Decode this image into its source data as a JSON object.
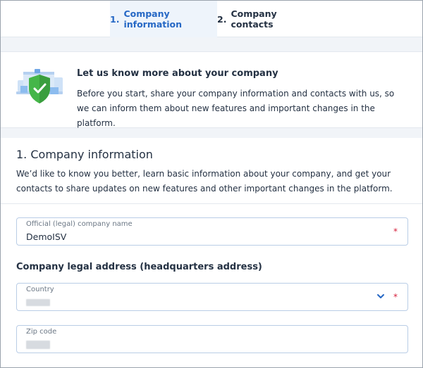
{
  "tabs": [
    {
      "number": "1.",
      "label": "Company information",
      "active": true
    },
    {
      "number": "2.",
      "label": "Company contacts",
      "active": false
    }
  ],
  "intro": {
    "title": "Let us know more about your company",
    "text": "Before you start, share your company information and contacts with us, so we can inform them about new features and important changes in the platform.",
    "icon": "shield-check-icon"
  },
  "section": {
    "title": "1. Company information",
    "description": "We’d like to know you better, learn basic information about your company, and get your contacts to share updates on new features and other important changes in the platform."
  },
  "fields": {
    "company_name": {
      "label": "Official (legal) company name",
      "value": "DemoISV",
      "required_mark": "*"
    },
    "address_heading": "Company legal address (headquarters address)",
    "country": {
      "label": "Country",
      "value": "",
      "required_mark": "*",
      "icon": "chevron-down-icon"
    },
    "zip": {
      "label": "Zip code",
      "value": ""
    }
  },
  "colors": {
    "accent": "#2668c5",
    "active_tab_bg": "#eef4fb",
    "required": "#d6203c",
    "text": "#243143"
  }
}
